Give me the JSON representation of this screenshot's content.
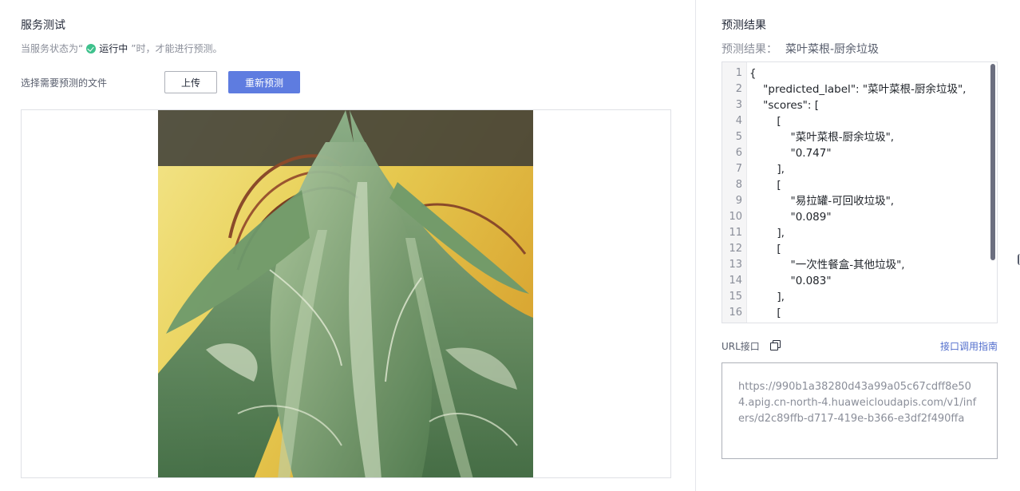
{
  "service_test": {
    "title": "服务测试",
    "status_prefix": "当服务状态为“",
    "status_running": "运行中",
    "status_suffix": "”时，才能进行预测。",
    "file_label": "选择需要预测的文件",
    "upload_label": "上传",
    "repredict_label": "重新预测",
    "image_subject": "green leafy vegetables photo"
  },
  "prediction": {
    "title": "预测结果",
    "result_label": "预测结果：",
    "result_value": "菜叶菜根-厨余垃圾",
    "line_numbers": [
      "1",
      "2",
      "3",
      "4",
      "5",
      "6",
      "7",
      "8",
      "9",
      "10",
      "11",
      "12",
      "13",
      "14",
      "15",
      "16"
    ],
    "code_lines": [
      "{",
      "    \"predicted_label\": \"菜叶菜根-厨余垃圾\",",
      "    \"scores\": [",
      "        [",
      "            \"菜叶菜根-厨余垃圾\",",
      "            \"0.747\"",
      "        ],",
      "        [",
      "            \"易拉罐-可回收垃圾\",",
      "            \"0.089\"",
      "        ],",
      "        [",
      "            \"一次性餐盒-其他垃圾\",",
      "            \"0.083\"",
      "        ],",
      "        ["
    ]
  },
  "url": {
    "label": "URL接口",
    "guide_label": "接口调用指南",
    "value": "https://990b1a38280d43a99a05c67cdff8e504.apig.cn-north-4.huaweicloudapis.com/v1/infers/d2c89ffb-d717-419e-b366-e3df2f490ffa"
  },
  "colors": {
    "primary": "#5e7ce0",
    "link": "#526ecc",
    "running": "#3ec18c"
  }
}
